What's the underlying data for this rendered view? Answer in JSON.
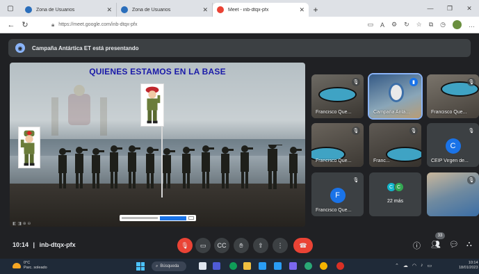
{
  "browser": {
    "tabs": [
      {
        "title": "Zona de Usuarios",
        "favicon_color": "#2a6ebb",
        "active": false
      },
      {
        "title": "Zona de Usuarios",
        "favicon_color": "#2a6ebb",
        "active": false
      },
      {
        "title": "Meet - inb-dtqx-pfx",
        "favicon_color": "#ea4335",
        "active": true
      }
    ],
    "new_tab": "+",
    "url": "https://meet.google.com/inb-dtqx-pfx"
  },
  "banner": {
    "text": "Campaña Antártica ET está presentando"
  },
  "presentation": {
    "title": "QUIENES ESTAMOS EN LA BASE"
  },
  "participants": [
    {
      "name": "Francisco Que...",
      "type": "video",
      "muted": true
    },
    {
      "name": "Campaña Antá...",
      "type": "video",
      "muted": false,
      "selected": true
    },
    {
      "name": "Francisco Que...",
      "type": "video",
      "muted": true
    },
    {
      "name": "Francisco Que...",
      "type": "video",
      "muted": true
    },
    {
      "name": "Franc...",
      "type": "video",
      "muted": true
    },
    {
      "name": "CEIP Virgen de...",
      "type": "avatar",
      "letter": "C",
      "muted": true
    },
    {
      "name": "Francisco Que...",
      "type": "avatar",
      "letter": "F",
      "muted": true
    },
    {
      "name": "22 más",
      "type": "more",
      "letters": [
        "C",
        "C"
      ]
    },
    {
      "name": "",
      "type": "video",
      "muted": true
    }
  ],
  "controls": {
    "time": "10:14",
    "separator": "|",
    "meeting_code": "inb-dtqx-pfx",
    "participant_count": "33",
    "icons": [
      "mic-off-icon",
      "camera-icon",
      "captions-icon",
      "raise-hand-icon",
      "present-icon",
      "more-options-icon",
      "hangup-icon"
    ]
  },
  "taskbar": {
    "weather_temp": "0°C",
    "weather_desc": "Parc. soleado",
    "search_label": "Búsqueda",
    "clock_time": "10:14",
    "clock_date": "18/01/2023"
  },
  "colors": {
    "meet_bg": "#202124",
    "tile_bg": "#3c4043",
    "hangup_red": "#ea4335",
    "accent_blue": "#1a73e8",
    "slide_title_blue": "#1a1aa8"
  }
}
